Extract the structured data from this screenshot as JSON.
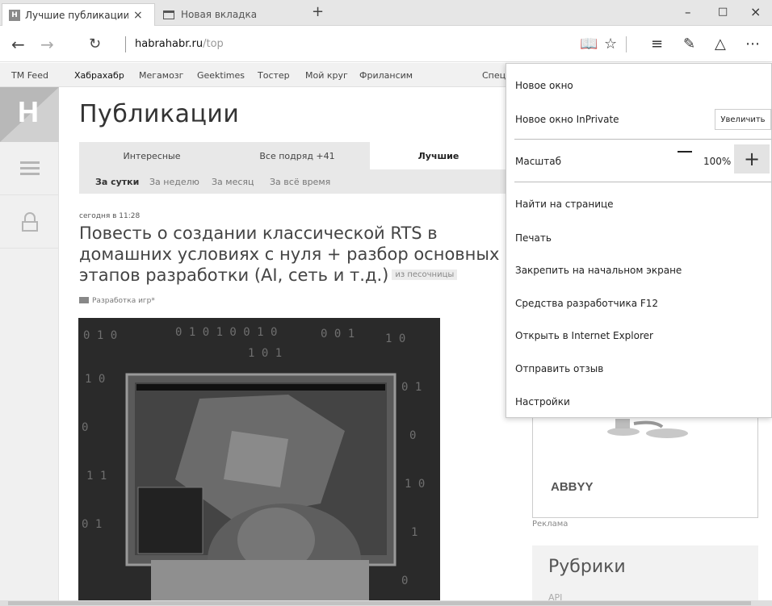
{
  "tabs": {
    "active": {
      "favicon": "H",
      "title": "Лучшие публикации за",
      "close": "×"
    },
    "inactive": {
      "title": "Новая вкладка"
    },
    "new_tab": "+"
  },
  "window": {
    "minimize": "–",
    "maximize": "□",
    "close": "×"
  },
  "address": {
    "host": "habrahabr.ru",
    "path": "/top"
  },
  "toolbar_icons": [
    "back-icon",
    "forward-icon",
    "refresh-icon",
    "reading-view-icon",
    "favorite-star-icon",
    "hub-icon",
    "web-note-icon",
    "share-icon",
    "more-icon"
  ],
  "top_nav": {
    "items": [
      "TM Feed",
      "Хабрахабр",
      "Мегамозг",
      "Geektimes",
      "Тостер",
      "Мой круг",
      "Фрилансим",
      "Спец"
    ]
  },
  "logo": "H",
  "page": {
    "title": "Публикации",
    "tabs": [
      "Интересные",
      "Все подряд +41",
      "Лучшие"
    ],
    "subtabs": [
      "За сутки",
      "За неделю",
      "За месяц",
      "За всё время"
    ]
  },
  "post": {
    "date": "сегодня в 11:28",
    "title_lines": [
      "Повесть о создании классической RTS в",
      "домашних условиях с нуля + разбор основных",
      "этапов разработки (AI, сеть и т.д.)"
    ],
    "sandbox_label": "из песочницы",
    "hub": "Разработка игр*"
  },
  "sidebar_right": {
    "ad_brand": "ABBYY",
    "ad_label": "Реклама",
    "rubrics_title": "Рубрики",
    "rubrics_first": "API"
  },
  "menu": {
    "new_window": "Новое окно",
    "new_private": "Новое окно InPrivate",
    "enlarge_btn": "Увеличить",
    "zoom_label": "Масштаб",
    "zoom_minus": "—",
    "zoom_value": "100%",
    "zoom_plus": "+",
    "find": "Найти на странице",
    "print": "Печать",
    "pin": "Закрепить на начальном экране",
    "devtools": "Средства разработчика F12",
    "open_ie": "Открыть в Internet Explorer",
    "feedback": "Отправить отзыв",
    "settings": "Настройки"
  }
}
